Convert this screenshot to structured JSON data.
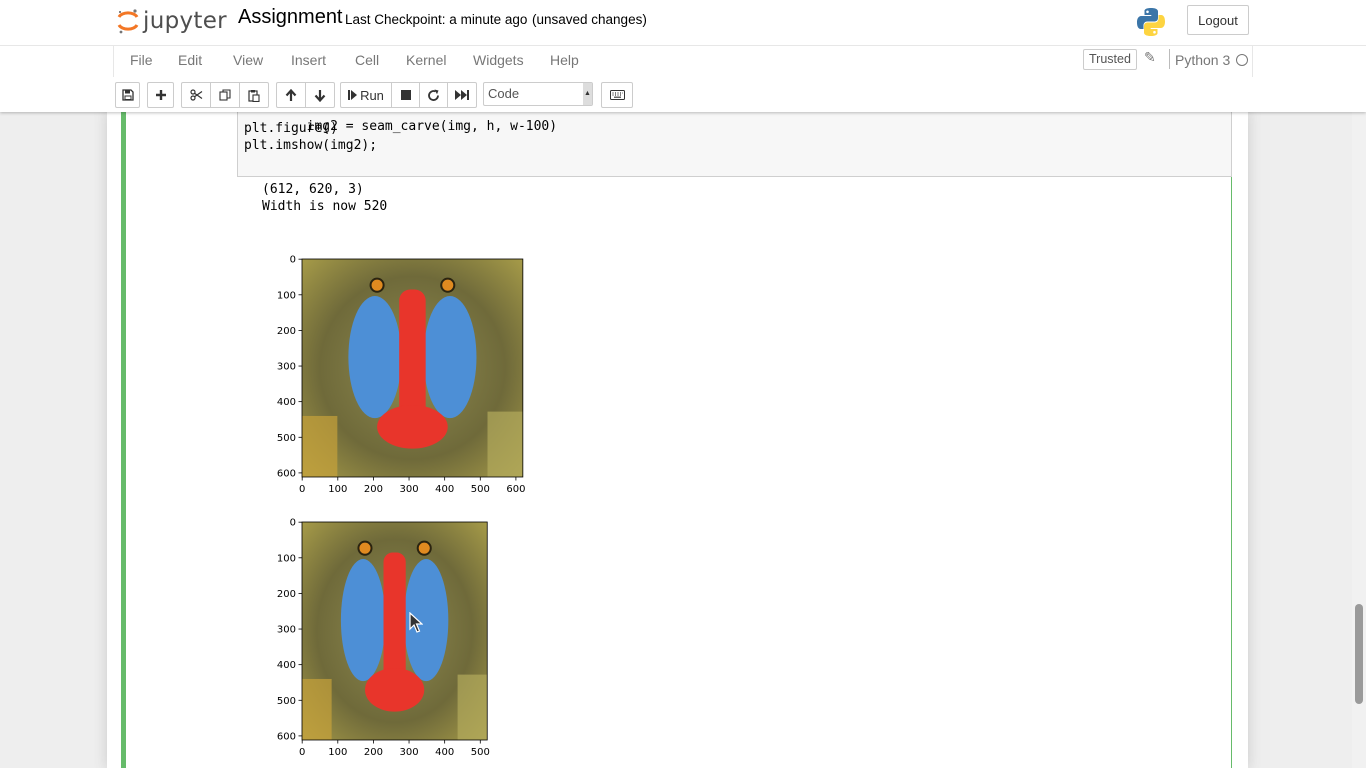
{
  "header": {
    "logo_text": "jupyter",
    "notebook_name": "Assignment",
    "checkpoint": "Last Checkpoint: a minute ago",
    "autosave_status": "(unsaved changes)",
    "logout_label": "Logout"
  },
  "menubar": {
    "items": [
      "File",
      "Edit",
      "View",
      "Insert",
      "Cell",
      "Kernel",
      "Widgets",
      "Help"
    ],
    "trusted_label": "Trusted",
    "kernel_name": "Python 3"
  },
  "toolbar": {
    "run_label": "Run",
    "cell_type": "Code"
  },
  "cell": {
    "code_line_1_partial": "img2 = seam_carve(img, h, w-100)",
    "code_line_2": "plt.figure()",
    "code_line_3": "plt.imshow(img2);",
    "output_line_1": "(612, 620, 3)",
    "output_line_2": "Width is now 520"
  },
  "plots": [
    {
      "type": "image",
      "y_ticks": [
        "0",
        "100",
        "200",
        "300",
        "400",
        "500",
        "600"
      ],
      "x_ticks": [
        "0",
        "100",
        "200",
        "300",
        "400",
        "500",
        "600"
      ],
      "image_shape": [
        612,
        620
      ]
    },
    {
      "type": "image",
      "y_ticks": [
        "0",
        "100",
        "200",
        "300",
        "400",
        "500",
        "600"
      ],
      "x_ticks": [
        "0",
        "100",
        "200",
        "300",
        "400",
        "500"
      ],
      "image_shape": [
        612,
        520
      ]
    }
  ],
  "colors": {
    "cell_border": "#66bb6a",
    "baboon_nose": "#e8352b",
    "baboon_cheeks": "#4d8fd6"
  }
}
